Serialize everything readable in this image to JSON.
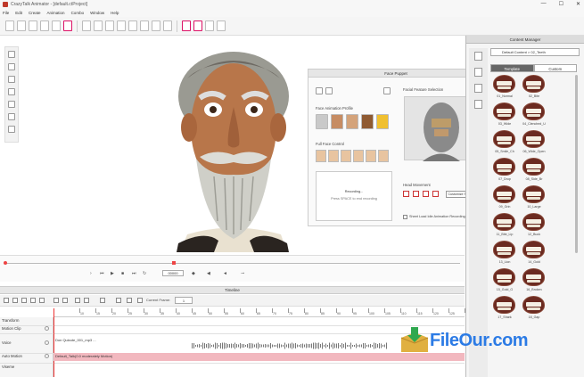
{
  "window": {
    "title": "CrazyTalk Animator - [default.ctProject]",
    "controls": [
      "—",
      "☐",
      "✕"
    ]
  },
  "menu": [
    "File",
    "Edit",
    "Create",
    "Animation",
    "Combo",
    "Window",
    "Help"
  ],
  "face_puppet": {
    "title": "Face Puppet",
    "sections": {
      "profile": "Face Animation Profile",
      "full_face": "Full Face Control",
      "feature": "Facial Feature Selection",
      "head_movement": "Head Movement"
    },
    "record_box_text": "Recording...",
    "hint": "Press SPACE to end recording",
    "custom_button": "Customize Settings",
    "checkbox_label": "Sheet Load Idle Animation Recording"
  },
  "playback": {
    "frame_value": "00000"
  },
  "timeline": {
    "title": "Timeline",
    "current_frame_label": "Current Frame:",
    "current_frame_value": "1",
    "ruler": [
      "10",
      "15",
      "20",
      "25",
      "30",
      "35",
      "40",
      "45",
      "50",
      "55",
      "60",
      "65",
      "70",
      "75",
      "80",
      "85",
      "90",
      "95",
      "100",
      "105",
      "110",
      "115",
      "120",
      "125",
      "130"
    ],
    "tracks": [
      "Transform",
      "Motion Clip",
      "Voice",
      "Auto Motion",
      "Viseme"
    ],
    "voice_clip": "Don Quixote_001_mp3 ...",
    "auto_motion_clip": "Default_Talk(0.0 moderately Motion)"
  },
  "content_manager": {
    "title": "Content Manager",
    "path": "Default Content > 02_Teeth",
    "tabs": [
      "Template",
      "Custom"
    ],
    "items": [
      "01_Normal",
      "02_Bite",
      "03_Wide",
      "04_Clenched_U",
      "05_Smile_Ch",
      "06_Wide_Open",
      "07_Drop",
      "08_Side_Br",
      "09_Grin",
      "10_Large",
      "11_Bite_Lip",
      "12_Buck",
      "13_Lion",
      "14_Gold",
      "15_Gold_G",
      "16_Broken",
      "17_Shark",
      "18_Gap"
    ]
  },
  "watermark": {
    "text": "FileOur.com"
  },
  "colors": {
    "accent": "#c0392b",
    "timeline_clip": "#f2b8bf",
    "tab_active": "#666666",
    "watermark": "#2c7be5"
  }
}
